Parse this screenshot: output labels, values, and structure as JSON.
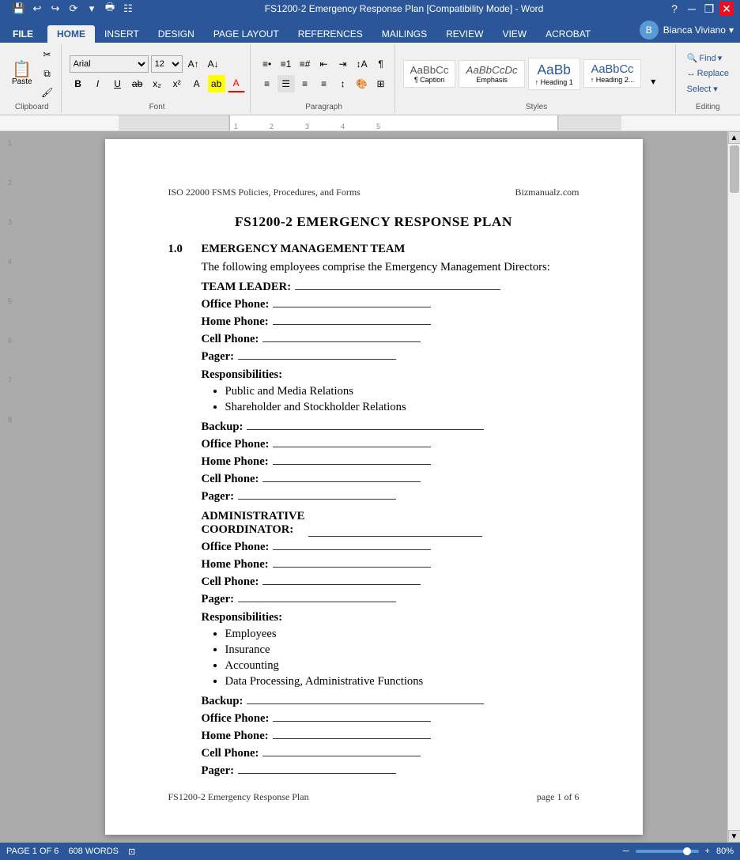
{
  "titlebar": {
    "title": "FS1200-2 Emergency Response Plan [Compatibility Mode] - Word",
    "help_icon": "?",
    "minimize_icon": "─",
    "restore_icon": "❐",
    "close_icon": "✕"
  },
  "ribbon": {
    "file_tab": "FILE",
    "tabs": [
      "HOME",
      "INSERT",
      "DESIGN",
      "PAGE LAYOUT",
      "REFERENCES",
      "MAILINGS",
      "REVIEW",
      "VIEW",
      "ACROBAT"
    ],
    "active_tab": "HOME",
    "font_name": "Arial",
    "font_size": "12",
    "clipboard_group": "Clipboard",
    "font_group": "Font",
    "paragraph_group": "Paragraph",
    "styles_group": "Styles",
    "editing_group": "Editing",
    "find_label": "Find",
    "replace_label": "Replace",
    "select_label": "Select ▾",
    "style_items": [
      {
        "label": "AaBbCc",
        "name": "Caption"
      },
      {
        "label": "AaBbCcDc",
        "name": "Emphasis"
      },
      {
        "label": "AaBb",
        "name": "Heading 1"
      },
      {
        "label": "AaBbCc",
        "name": "Heading 2"
      }
    ]
  },
  "user": {
    "name": "Bianca Viviano",
    "avatar": "B"
  },
  "document": {
    "header_left": "ISO 22000 FSMS Policies, Procedures, and Forms",
    "header_right": "Bizmanualz.com",
    "title": "FS1200-2 EMERGENCY RESPONSE PLAN",
    "section_num": "1.0",
    "section_title": "EMERGENCY MANAGEMENT TEAM",
    "intro_text": "The following employees comprise the Emergency Management Directors:",
    "team_leader_label": "TEAM LEADER:",
    "fields": [
      {
        "label": "Office Phone:"
      },
      {
        "label": "Home Phone:"
      },
      {
        "label": "Cell Phone:"
      },
      {
        "label": "Pager:"
      }
    ],
    "responsibilities_label": "Responsibilities:",
    "team_leader_responsibilities": [
      "Public and Media Relations",
      "Shareholder and Stockholder Relations"
    ],
    "backup_label": "Backup:",
    "backup_fields": [
      {
        "label": "Office Phone:"
      },
      {
        "label": "Home Phone:"
      },
      {
        "label": "Cell Phone:"
      },
      {
        "label": "Pager:"
      }
    ],
    "admin_coordinator_label": "ADMINISTRATIVE COORDINATOR:",
    "admin_fields": [
      {
        "label": "Office Phone:"
      },
      {
        "label": "Home Phone:"
      },
      {
        "label": "Cell Phone:"
      },
      {
        "label": "Pager:"
      }
    ],
    "admin_responsibilities_label": "Responsibilities:",
    "admin_responsibilities": [
      "Employees",
      "Insurance",
      "Accounting",
      "Data Processing, Administrative Functions"
    ],
    "backup2_label": "Backup:",
    "backup2_fields": [
      {
        "label": "Office Phone:"
      },
      {
        "label": "Home Phone:"
      },
      {
        "label": "Cell Phone:"
      },
      {
        "label": "Pager:"
      }
    ],
    "footer_left": "FS1200-2 Emergency Response Plan",
    "footer_right": "page 1 of 6"
  },
  "statusbar": {
    "page_info": "PAGE 1 OF 6",
    "word_count": "608 WORDS",
    "layout_icon": "⊡",
    "zoom_level": "80%",
    "zoom_minus": "─",
    "zoom_plus": "+"
  }
}
